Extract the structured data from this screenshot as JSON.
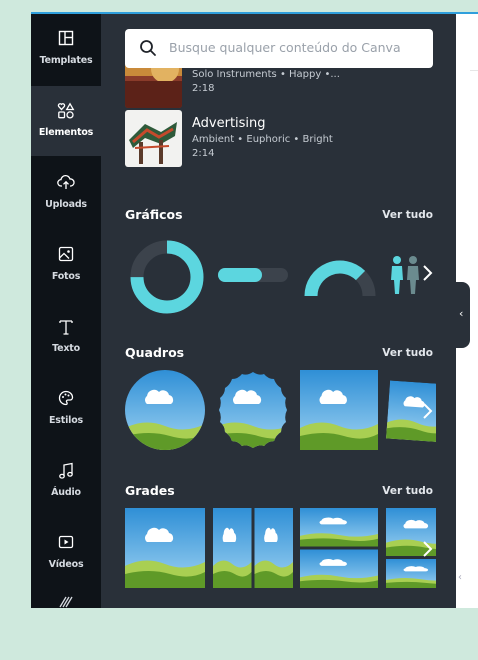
{
  "sidebar": {
    "items": [
      {
        "label": "Templates",
        "icon": "templates-icon"
      },
      {
        "label": "Elementos",
        "icon": "elements-icon",
        "active": true
      },
      {
        "label": "Uploads",
        "icon": "cloud-upload-icon"
      },
      {
        "label": "Fotos",
        "icon": "photo-icon"
      },
      {
        "label": "Texto",
        "icon": "text-icon"
      },
      {
        "label": "Estilos",
        "icon": "palette-icon"
      },
      {
        "label": "Áudio",
        "icon": "music-note-icon"
      },
      {
        "label": "Vídeos",
        "icon": "video-icon"
      },
      {
        "label": "",
        "icon": "pattern-icon"
      }
    ]
  },
  "search": {
    "placeholder": "Busque qualquer conteúdo do Canva"
  },
  "audio_tracks": [
    {
      "title": "",
      "subtitle": "Solo Instruments • Happy •...",
      "duration": "2:18"
    },
    {
      "title": "Advertising",
      "subtitle": "Ambient • Euphoric • Bright",
      "duration": "2:14"
    }
  ],
  "sections": {
    "graficos": {
      "title": "Gráficos",
      "see_all": "Ver tudo"
    },
    "quadros": {
      "title": "Quadros",
      "see_all": "Ver tudo"
    },
    "grades": {
      "title": "Grades",
      "see_all": "Ver tudo"
    }
  },
  "colors": {
    "accent": "#5cd6df",
    "panel_bg": "#293039",
    "rail_bg": "#0e1318",
    "sky": "#3a9bd9",
    "grass": "#6aa62f"
  }
}
